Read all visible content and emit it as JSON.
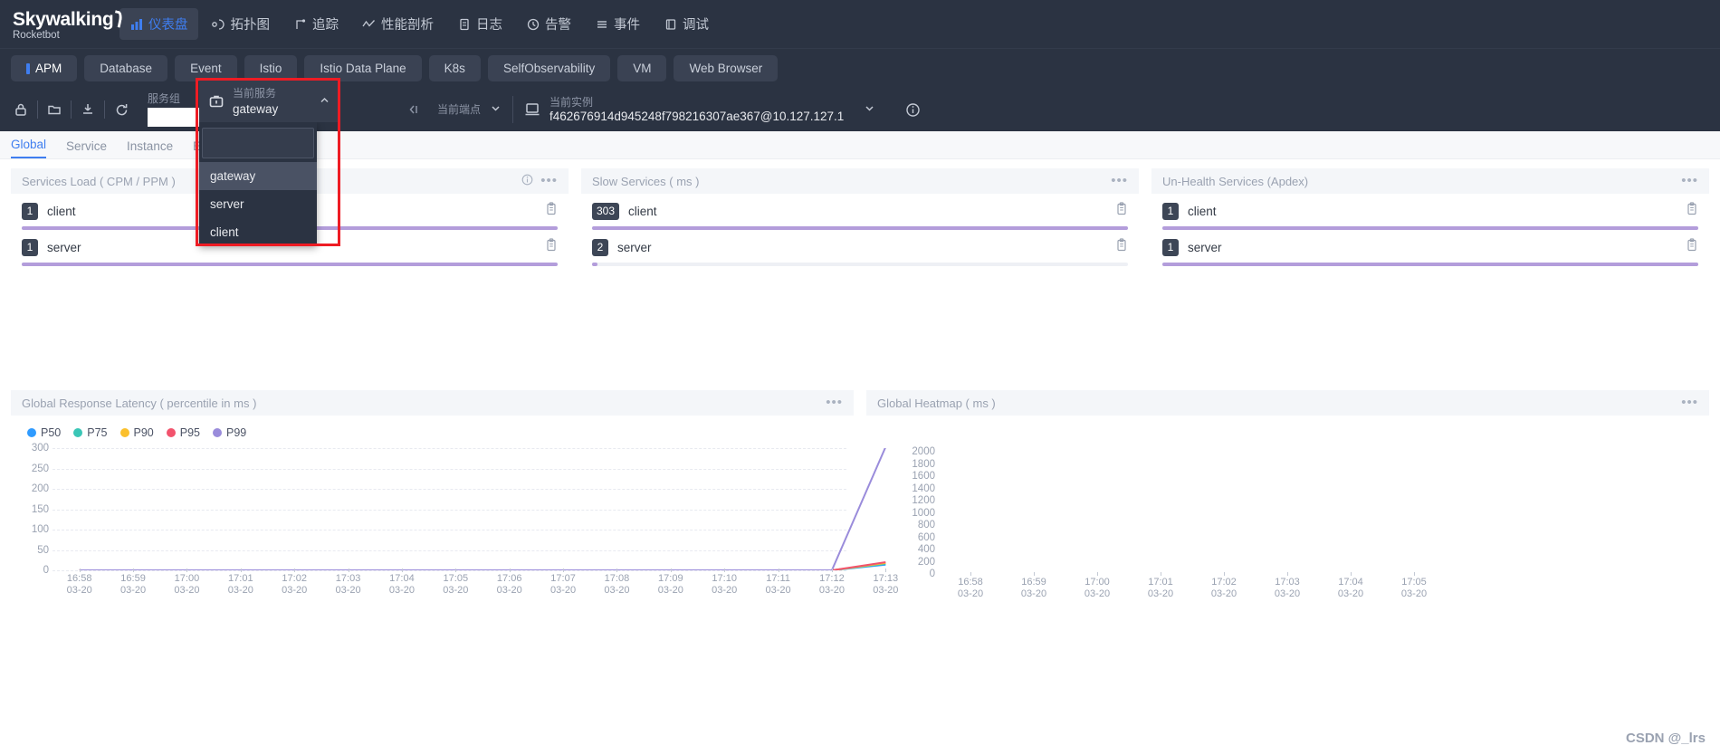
{
  "brand": {
    "name": "Skywalking",
    "sub": "Rocketbot"
  },
  "nav": {
    "items": [
      {
        "label": "仪表盘",
        "icon": "dashboard-icon",
        "active": true
      },
      {
        "label": "拓扑图",
        "icon": "topology-icon",
        "active": false
      },
      {
        "label": "追踪",
        "icon": "trace-icon",
        "active": false
      },
      {
        "label": "性能剖析",
        "icon": "profile-icon",
        "active": false
      },
      {
        "label": "日志",
        "icon": "log-icon",
        "active": false
      },
      {
        "label": "告警",
        "icon": "alarm-icon",
        "active": false
      },
      {
        "label": "事件",
        "icon": "event-icon",
        "active": false
      },
      {
        "label": "调试",
        "icon": "debug-icon",
        "active": false
      }
    ]
  },
  "tabs": {
    "items": [
      {
        "label": "APM",
        "active": true
      },
      {
        "label": "Database",
        "active": false
      },
      {
        "label": "Event",
        "active": false
      },
      {
        "label": "Istio",
        "active": false
      },
      {
        "label": "Istio Data Plane",
        "active": false
      },
      {
        "label": "K8s",
        "active": false
      },
      {
        "label": "SelfObservability",
        "active": false
      },
      {
        "label": "VM",
        "active": false
      },
      {
        "label": "Web Browser",
        "active": false
      }
    ]
  },
  "toolbar": {
    "icons": [
      "lock-icon",
      "folder-icon",
      "download-icon",
      "refresh-icon"
    ],
    "service_group": {
      "label": "服务组",
      "value": "",
      "placeholder": ""
    },
    "service": {
      "label": "当前服务",
      "value": "gateway",
      "icon": "service-icon",
      "chevron": "chevron-up-icon"
    },
    "endpoint": {
      "label": "当前端点",
      "value": "",
      "icon": "endpoint-icon",
      "chevron": "chevron-down-icon"
    },
    "instance": {
      "label": "当前实例",
      "value": "f462676914d945248f798216307ae367@10.127.127.1",
      "icon": "instance-icon",
      "chevron": "chevron-down-icon"
    },
    "info_icon": "info-circle-icon"
  },
  "service_dropdown": {
    "search_value": "",
    "options": [
      {
        "label": "gateway",
        "highlighted": true
      },
      {
        "label": "server",
        "highlighted": false
      },
      {
        "label": "client",
        "highlighted": false
      }
    ]
  },
  "subtabs": {
    "items": [
      {
        "label": "Global",
        "active": true
      },
      {
        "label": "Service",
        "active": false
      },
      {
        "label": "Instance",
        "active": false
      },
      {
        "label": "Endpoint",
        "active": false
      }
    ]
  },
  "cards": [
    {
      "title": "Services Load ( CPM / PPM )",
      "has_info": true,
      "rows": [
        {
          "value": "1",
          "name": "client",
          "pct": 100
        },
        {
          "value": "1",
          "name": "server",
          "pct": 100
        }
      ]
    },
    {
      "title": "Slow Services ( ms )",
      "has_info": false,
      "rows": [
        {
          "value": "303",
          "name": "client",
          "pct": 100
        },
        {
          "value": "2",
          "name": "server",
          "pct": 1
        }
      ]
    },
    {
      "title": "Un-Health Services (Apdex)",
      "has_info": false,
      "rows": [
        {
          "value": "1",
          "name": "client",
          "pct": 100
        },
        {
          "value": "1",
          "name": "server",
          "pct": 100
        }
      ]
    }
  ],
  "colors": {
    "accent": "#3f7ef0",
    "bar": "#b39ddb",
    "navbar": "#2b3342",
    "highlight_box": "#ee1c24",
    "p50": "#2f9bff",
    "p75": "#3ac6b6",
    "p90": "#fbc02d",
    "p95": "#f2536d",
    "p99": "#9a8cdb"
  },
  "chart_data": [
    {
      "type": "line",
      "title": "Global Response Latency ( percentile in ms )",
      "xlabel": "",
      "ylabel": "",
      "ylim": [
        0,
        300
      ],
      "yticks": [
        0,
        50,
        100,
        150,
        200,
        250,
        300
      ],
      "grid": true,
      "legend_position": "top-left",
      "x": [
        "16:58\n03-20",
        "16:59\n03-20",
        "17:00\n03-20",
        "17:01\n03-20",
        "17:02\n03-20",
        "17:03\n03-20",
        "17:04\n03-20",
        "17:05\n03-20",
        "17:06\n03-20",
        "17:07\n03-20",
        "17:08\n03-20",
        "17:09\n03-20",
        "17:10\n03-20",
        "17:11\n03-20",
        "17:12\n03-20",
        "17:13\n03-20"
      ],
      "series": [
        {
          "name": "P50",
          "color": "#2f9bff",
          "values": [
            0,
            0,
            0,
            0,
            0,
            0,
            0,
            0,
            0,
            0,
            0,
            0,
            0,
            0,
            0,
            14
          ]
        },
        {
          "name": "P75",
          "color": "#3ac6b6",
          "values": [
            0,
            0,
            0,
            0,
            0,
            0,
            0,
            0,
            0,
            0,
            0,
            0,
            0,
            0,
            0,
            16
          ]
        },
        {
          "name": "P90",
          "color": "#fbc02d",
          "values": [
            0,
            0,
            0,
            0,
            0,
            0,
            0,
            0,
            0,
            0,
            0,
            0,
            0,
            0,
            0,
            18
          ]
        },
        {
          "name": "P95",
          "color": "#f2536d",
          "values": [
            0,
            0,
            0,
            0,
            0,
            0,
            0,
            0,
            0,
            0,
            0,
            0,
            0,
            0,
            0,
            20
          ]
        },
        {
          "name": "P99",
          "color": "#9a8cdb",
          "values": [
            0,
            0,
            0,
            0,
            0,
            0,
            0,
            0,
            0,
            0,
            0,
            0,
            0,
            0,
            0,
            303
          ]
        }
      ]
    },
    {
      "type": "heatmap",
      "title": "Global Heatmap ( ms )",
      "xlabel": "",
      "ylabel": "",
      "ylim": [
        0,
        2000
      ],
      "yticks": [
        0,
        200,
        400,
        600,
        800,
        1000,
        1200,
        1400,
        1600,
        1800,
        2000
      ],
      "grid": false,
      "x": [
        "16:58\n03-20",
        "16:59\n03-20",
        "17:00\n03-20",
        "17:01\n03-20",
        "17:02\n03-20",
        "17:03\n03-20",
        "17:04\n03-20",
        "17:05\n03-20"
      ],
      "values": []
    }
  ],
  "watermark": "CSDN @_lrs"
}
